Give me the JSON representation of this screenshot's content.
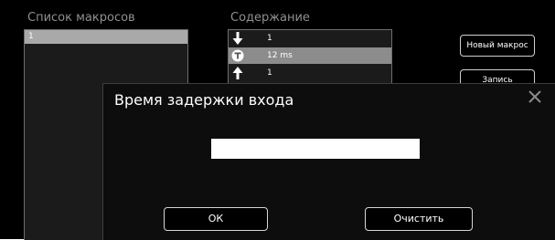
{
  "macro_list": {
    "title": "Список макросов",
    "items": [
      "1"
    ]
  },
  "content": {
    "title": "Содержание",
    "rows": [
      {
        "icon": "arrow-down-icon",
        "text": "1",
        "selected": false
      },
      {
        "icon": "timer-icon",
        "text": "12 ms",
        "selected": true
      },
      {
        "icon": "arrow-up-icon",
        "text": "1",
        "selected": false
      }
    ]
  },
  "side_buttons": {
    "new_macro": "Новый макрос",
    "record": "Запись"
  },
  "dialog": {
    "title": "Время задержки входа",
    "input_left_value": "",
    "input_right_value": "",
    "ok_label": "ОК",
    "clear_label": "Очистить",
    "close_icon": "close-icon"
  },
  "colors": {
    "background": "#000000",
    "heading": "#8f8f8f",
    "selected_row": "#8c8c8c",
    "macro_item": "#a9a9a9"
  }
}
